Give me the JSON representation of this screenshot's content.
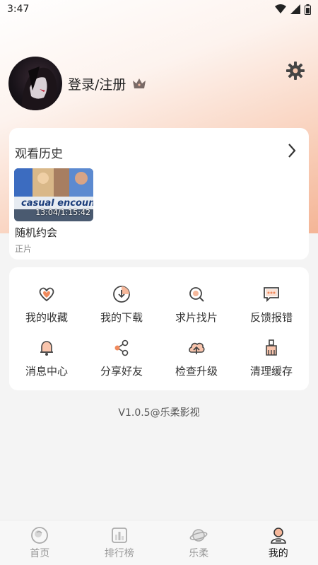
{
  "status": {
    "time": "3:47"
  },
  "profile": {
    "login_label": "登录/注册"
  },
  "history": {
    "title": "观看历史",
    "item": {
      "title": "随机约会",
      "subtitle": "正片",
      "progress": "13:04/1:15:42",
      "poster_text": "casual encounters"
    }
  },
  "features": [
    {
      "label": "我的收藏",
      "icon": "heart-icon"
    },
    {
      "label": "我的下载",
      "icon": "download-icon"
    },
    {
      "label": "求片找片",
      "icon": "search-icon"
    },
    {
      "label": "反馈报错",
      "icon": "message-icon"
    },
    {
      "label": "消息中心",
      "icon": "bell-icon"
    },
    {
      "label": "分享好友",
      "icon": "share-icon"
    },
    {
      "label": "检查升级",
      "icon": "cloud-upload-icon"
    },
    {
      "label": "清理缓存",
      "icon": "broom-icon"
    }
  ],
  "version": "V1.0.5@乐柔影视",
  "tabs": [
    {
      "label": "首页",
      "icon": "home-icon",
      "active": false
    },
    {
      "label": "排行榜",
      "icon": "ranking-icon",
      "active": false
    },
    {
      "label": "乐柔",
      "icon": "planet-icon",
      "active": false
    },
    {
      "label": "我的",
      "icon": "profile-icon",
      "active": true
    }
  ],
  "colors": {
    "accent": "#f08a5d",
    "gradient_end": "#f4b596"
  }
}
